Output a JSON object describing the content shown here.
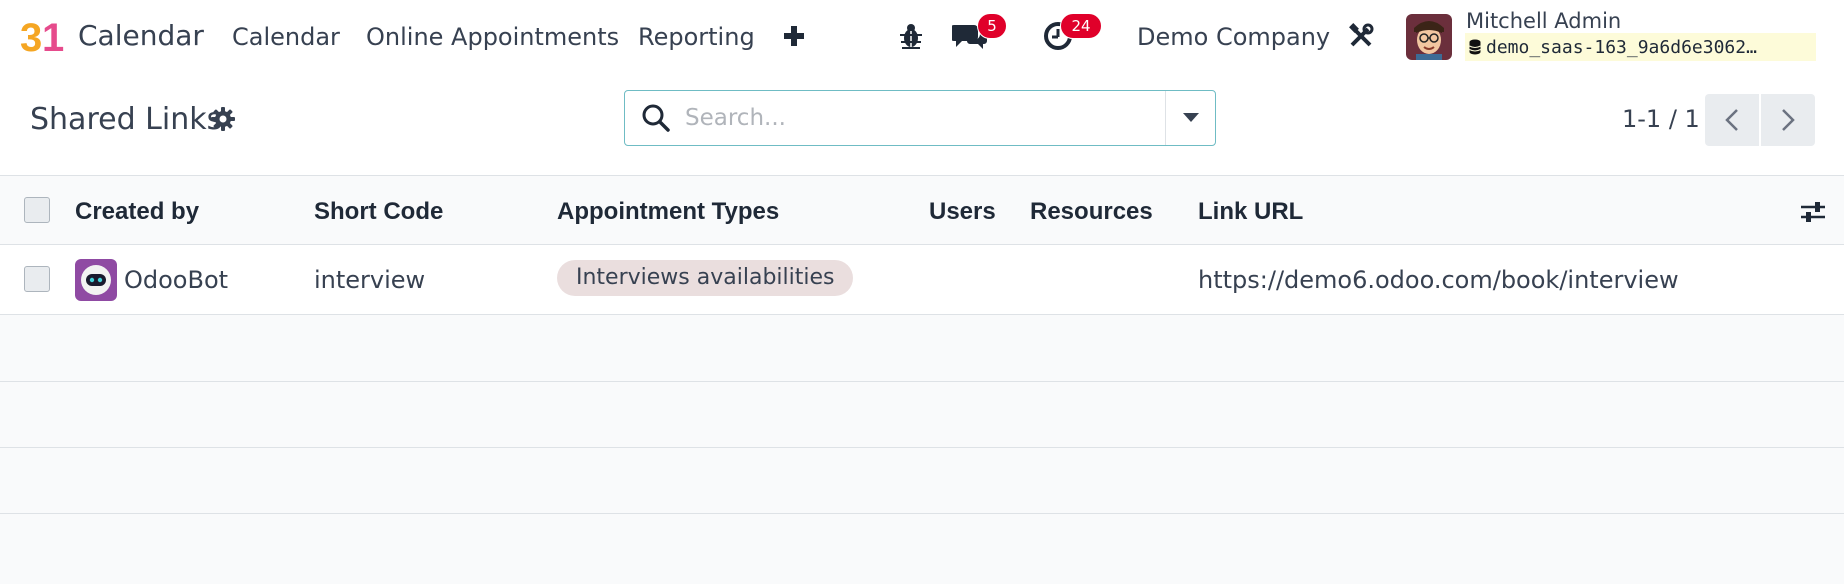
{
  "navbar": {
    "app_name": "Calendar",
    "menu": [
      "Calendar",
      "Online Appointments",
      "Reporting"
    ],
    "messages_count": "5",
    "activities_count": "24",
    "company": "Demo Company",
    "user_name": "Mitchell Admin",
    "database": "demo_saas-163_9a6d6e3062…",
    "icons": [
      "calendar-logo",
      "plus-icon",
      "bug-icon",
      "chat-icon",
      "clock-icon",
      "tools-icon",
      "database-icon"
    ]
  },
  "control_panel": {
    "title": "Shared Links",
    "search_placeholder": "Search...",
    "pager": "1-1 / 1"
  },
  "list": {
    "columns": [
      "Created by",
      "Short Code",
      "Appointment Types",
      "Users",
      "Resources",
      "Link URL"
    ],
    "rows": [
      {
        "created_by": "OdooBot",
        "short_code": "interview",
        "appointment_types": [
          "Interviews availabilities"
        ],
        "users": "",
        "resources": "",
        "link_url": "https://demo6.odoo.com/book/interview"
      }
    ]
  },
  "colors": {
    "badge": "#e0002a",
    "tag_bg": "#eadede",
    "search_border": "#6fbcc4",
    "db_bg": "#fdfbd9"
  }
}
